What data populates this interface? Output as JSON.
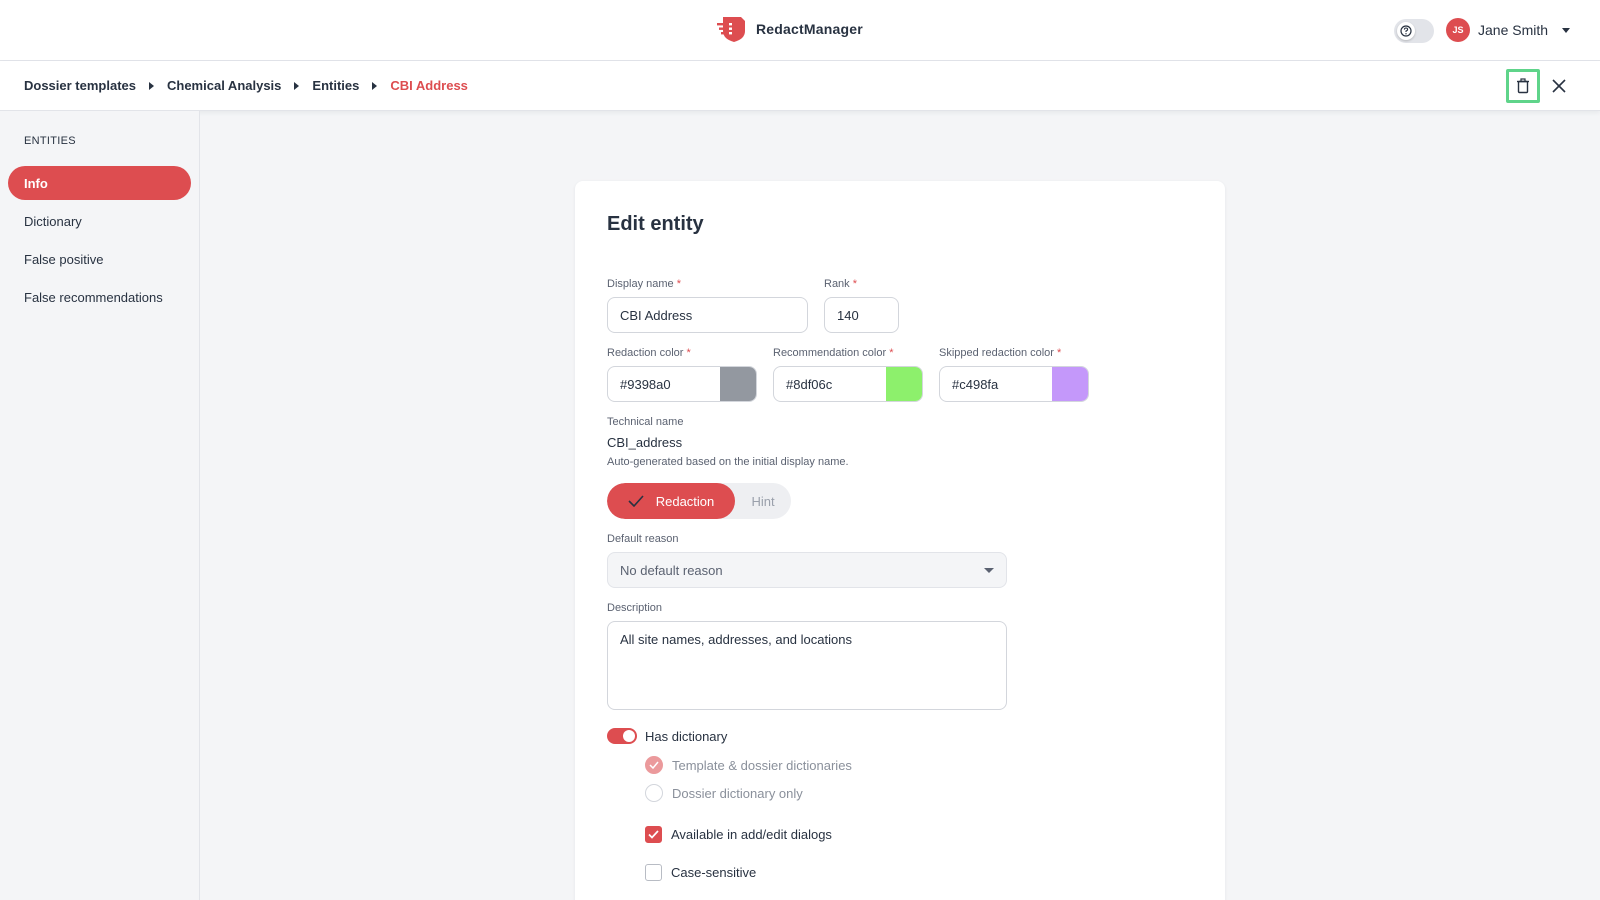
{
  "app": {
    "name": "RedactManager"
  },
  "user": {
    "initials": "JS",
    "name": "Jane Smith"
  },
  "breadcrumb": [
    "Dossier templates",
    "Chemical Analysis",
    "Entities",
    "CBI Address"
  ],
  "sidebar": {
    "title": "ENTITIES",
    "items": [
      {
        "label": "Info",
        "active": true
      },
      {
        "label": "Dictionary",
        "active": false
      },
      {
        "label": "False positive",
        "active": false
      },
      {
        "label": "False recommendations",
        "active": false
      }
    ]
  },
  "form": {
    "title": "Edit entity",
    "display_name": {
      "label": "Display name",
      "required": "*",
      "value": "CBI Address"
    },
    "rank": {
      "label": "Rank",
      "required": "*",
      "value": "140"
    },
    "redaction_color": {
      "label": "Redaction color",
      "required": "*",
      "value": "#9398a0"
    },
    "recommendation_color": {
      "label": "Recommendation color",
      "required": "*",
      "value": "#8df06c"
    },
    "skipped_color": {
      "label": "Skipped redaction color",
      "required": "*",
      "value": "#c498fa"
    },
    "technical_name": {
      "label": "Technical name",
      "value": "CBI_address",
      "hint": "Auto-generated based on the initial display name."
    },
    "type_toggle": {
      "selected": "Redaction",
      "other": "Hint"
    },
    "default_reason": {
      "label": "Default reason",
      "value": "No default reason"
    },
    "description": {
      "label": "Description",
      "value": "All site names, addresses, and locations"
    },
    "has_dictionary": {
      "label": "Has dictionary",
      "on": true
    },
    "dictionary_scope": [
      {
        "label": "Template & dossier dictionaries",
        "checked": true
      },
      {
        "label": "Dossier dictionary only",
        "checked": false
      }
    ],
    "available_in_dialogs": {
      "label": "Available in add/edit dialogs",
      "checked": true
    },
    "case_sensitive": {
      "label": "Case-sensitive",
      "checked": false
    }
  },
  "colors": {
    "accent": "#dd4d50",
    "highlight_border": "#5fd48a"
  },
  "icons": {
    "logo": "redact-logo-icon",
    "help": "help-icon",
    "delete": "trash-icon",
    "close": "close-icon"
  }
}
